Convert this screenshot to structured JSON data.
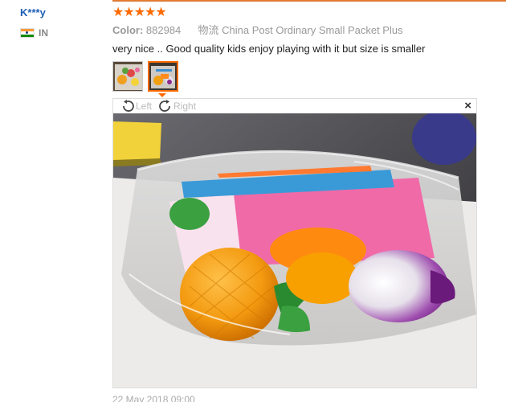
{
  "user": {
    "name": "K***y",
    "country_code": "IN",
    "flag_icon": "india-flag-icon"
  },
  "review": {
    "rating": 5,
    "stars_text": "★★★★★",
    "color_label": "Color:",
    "color_value": "882984",
    "shipping": "物流 China Post Ordinary Small Packet Plus",
    "text": "very nice .. Good quality kids enjoy playing with it but size is smaller",
    "date": "22 May 2018 09:00"
  },
  "viewer": {
    "rotate_left_label": "Left",
    "rotate_right_label": "Right",
    "close_label": "×"
  },
  "colors": {
    "accent": "#ff6a00",
    "username": "#1f5fb8"
  }
}
